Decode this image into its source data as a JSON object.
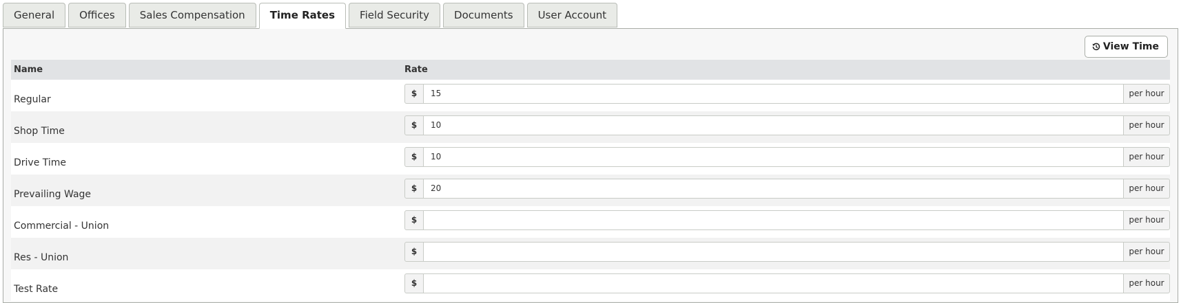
{
  "tabs": [
    {
      "label": "General",
      "active": false
    },
    {
      "label": "Offices",
      "active": false
    },
    {
      "label": "Sales Compensation",
      "active": false
    },
    {
      "label": "Time Rates",
      "active": true
    },
    {
      "label": "Field Security",
      "active": false
    },
    {
      "label": "Documents",
      "active": false
    },
    {
      "label": "User Account",
      "active": false
    }
  ],
  "toolbar": {
    "view_time_label": "View Time",
    "view_time_icon": "history-icon"
  },
  "table": {
    "headers": {
      "name": "Name",
      "rate": "Rate"
    },
    "currency_symbol": "$",
    "unit_label": "per hour",
    "rows": [
      {
        "name": "Regular",
        "rate": "15"
      },
      {
        "name": "Shop Time",
        "rate": "10"
      },
      {
        "name": "Drive Time",
        "rate": "10"
      },
      {
        "name": "Prevailing Wage",
        "rate": "20"
      },
      {
        "name": "Commercial - Union",
        "rate": ""
      },
      {
        "name": "Res - Union",
        "rate": ""
      },
      {
        "name": "Test Rate",
        "rate": ""
      }
    ]
  },
  "colors": {
    "tab_bg": "#e9ebe7",
    "active_tab_bg": "#ffffff",
    "header_bg": "#e1e3e5",
    "stripe_bg": "#f2f2f2"
  }
}
